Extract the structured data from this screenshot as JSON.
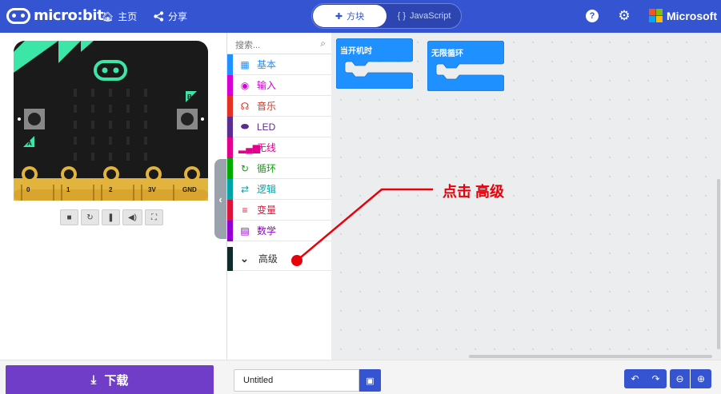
{
  "header": {
    "logo_text": "micro:bit",
    "home_label": "主页",
    "share_label": "分享",
    "tabs": [
      {
        "label": "方块",
        "selected": true,
        "icon": "puzzle-icon"
      },
      {
        "label": "JavaScript",
        "selected": false,
        "icon": "braces-icon"
      }
    ],
    "help_icon": "help-icon",
    "settings_icon": "gear-icon",
    "brand": "Microsoft",
    "brand_colors": [
      "#f35325",
      "#81bc06",
      "#05a6f0",
      "#ffba08"
    ]
  },
  "simulator": {
    "pins": [
      "0",
      "1",
      "2",
      "3V",
      "GND"
    ],
    "buttons": [
      "A",
      "B"
    ],
    "controls": [
      "stop-icon",
      "restart-icon",
      "slow-mo-icon",
      "sound-icon",
      "fullscreen-icon"
    ],
    "board_color": "#1a1a1a",
    "accent_color": "#3ce6a6"
  },
  "toolbox": {
    "search_placeholder": "搜索...",
    "categories": [
      {
        "label": "基本",
        "color": "#1e90ff",
        "icon": "grid-icon"
      },
      {
        "label": "输入",
        "color": "#d400d4",
        "icon": "target-icon"
      },
      {
        "label": "音乐",
        "color": "#e63022",
        "icon": "headphones-icon"
      },
      {
        "label": "LED",
        "color": "#5c2d91",
        "icon": "toggle-icon"
      },
      {
        "label": "无线",
        "color": "#e3008c",
        "icon": "signal-icon"
      },
      {
        "label": "循环",
        "color": "#00aa00",
        "icon": "loop-icon"
      },
      {
        "label": "逻辑",
        "color": "#00a4a6",
        "icon": "shuffle-icon"
      },
      {
        "label": "变量",
        "color": "#dc143c",
        "icon": "list-icon"
      },
      {
        "label": "数学",
        "color": "#9400d3",
        "icon": "calculator-icon"
      }
    ],
    "advanced_label": "高级"
  },
  "workspace": {
    "blocks": [
      {
        "label": "当开机时"
      },
      {
        "label": "无限循环"
      }
    ],
    "block_color": "#1e90ff"
  },
  "annotation": {
    "text": "点击 高级",
    "color": "#e8000b"
  },
  "footer": {
    "download_label": "下载",
    "project_name": "Untitled"
  }
}
